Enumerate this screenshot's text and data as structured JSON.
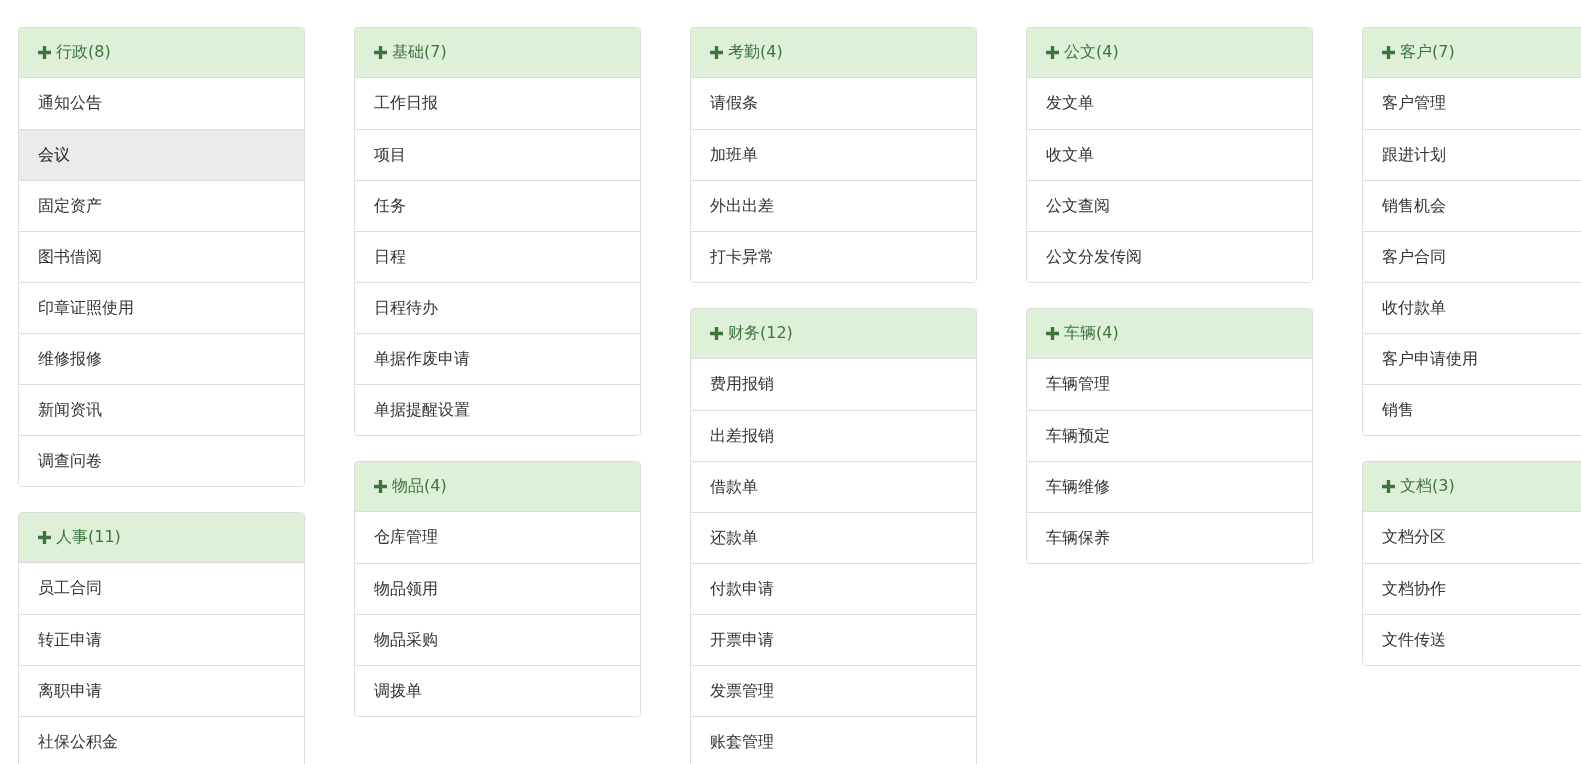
{
  "columns": [
    {
      "groups": [
        {
          "title": "行政(8)",
          "items": [
            {
              "label": "通知公告",
              "selected": false
            },
            {
              "label": "会议",
              "selected": true
            },
            {
              "label": "固定资产",
              "selected": false
            },
            {
              "label": "图书借阅",
              "selected": false
            },
            {
              "label": "印章证照使用",
              "selected": false
            },
            {
              "label": "维修报修",
              "selected": false
            },
            {
              "label": "新闻资讯",
              "selected": false
            },
            {
              "label": "调查问卷",
              "selected": false
            }
          ]
        },
        {
          "title": "人事(11)",
          "items": [
            {
              "label": "员工合同",
              "selected": false
            },
            {
              "label": "转正申请",
              "selected": false
            },
            {
              "label": "离职申请",
              "selected": false
            },
            {
              "label": "社保公积金",
              "selected": false
            }
          ]
        }
      ]
    },
    {
      "groups": [
        {
          "title": "基础(7)",
          "items": [
            {
              "label": "工作日报",
              "selected": false
            },
            {
              "label": "项目",
              "selected": false
            },
            {
              "label": "任务",
              "selected": false
            },
            {
              "label": "日程",
              "selected": false
            },
            {
              "label": "日程待办",
              "selected": false
            },
            {
              "label": "单据作废申请",
              "selected": false
            },
            {
              "label": "单据提醒设置",
              "selected": false
            }
          ]
        },
        {
          "title": "物品(4)",
          "items": [
            {
              "label": "仓库管理",
              "selected": false
            },
            {
              "label": "物品领用",
              "selected": false
            },
            {
              "label": "物品采购",
              "selected": false
            },
            {
              "label": "调拨单",
              "selected": false
            }
          ]
        }
      ]
    },
    {
      "groups": [
        {
          "title": "考勤(4)",
          "items": [
            {
              "label": "请假条",
              "selected": false
            },
            {
              "label": "加班单",
              "selected": false
            },
            {
              "label": "外出出差",
              "selected": false
            },
            {
              "label": "打卡异常",
              "selected": false
            }
          ]
        },
        {
          "title": "财务(12)",
          "items": [
            {
              "label": "费用报销",
              "selected": false
            },
            {
              "label": "出差报销",
              "selected": false
            },
            {
              "label": "借款单",
              "selected": false
            },
            {
              "label": "还款单",
              "selected": false
            },
            {
              "label": "付款申请",
              "selected": false
            },
            {
              "label": "开票申请",
              "selected": false
            },
            {
              "label": "发票管理",
              "selected": false
            },
            {
              "label": "账套管理",
              "selected": false
            }
          ]
        }
      ]
    },
    {
      "groups": [
        {
          "title": "公文(4)",
          "items": [
            {
              "label": "发文单",
              "selected": false
            },
            {
              "label": "收文单",
              "selected": false
            },
            {
              "label": "公文查阅",
              "selected": false
            },
            {
              "label": "公文分发传阅",
              "selected": false
            }
          ]
        },
        {
          "title": "车辆(4)",
          "items": [
            {
              "label": "车辆管理",
              "selected": false
            },
            {
              "label": "车辆预定",
              "selected": false
            },
            {
              "label": "车辆维修",
              "selected": false
            },
            {
              "label": "车辆保养",
              "selected": false
            }
          ]
        }
      ]
    },
    {
      "groups": [
        {
          "title": "客户(7)",
          "items": [
            {
              "label": "客户管理",
              "selected": false
            },
            {
              "label": "跟进计划",
              "selected": false
            },
            {
              "label": "销售机会",
              "selected": false
            },
            {
              "label": "客户合同",
              "selected": false
            },
            {
              "label": "收付款单",
              "selected": false
            },
            {
              "label": "客户申请使用",
              "selected": false
            },
            {
              "label": "销售",
              "selected": false
            }
          ]
        },
        {
          "title": "文档(3)",
          "items": [
            {
              "label": "文档分区",
              "selected": false
            },
            {
              "label": "文档协作",
              "selected": false
            },
            {
              "label": "文件传送",
              "selected": false
            }
          ]
        }
      ]
    }
  ]
}
